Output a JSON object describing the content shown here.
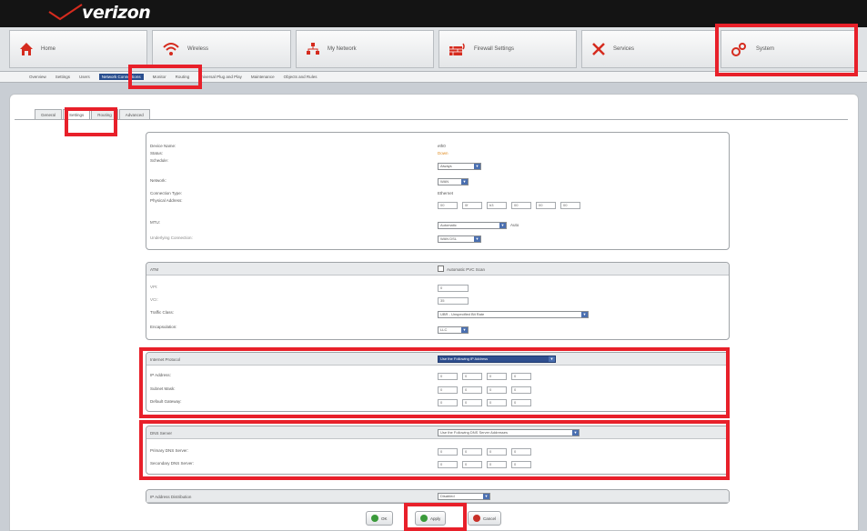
{
  "brand": {
    "name": "verizon"
  },
  "nav": [
    {
      "label": "Home",
      "icon": "home-icon"
    },
    {
      "label": "Wireless",
      "icon": "wireless-icon"
    },
    {
      "label": "My Network",
      "icon": "network-icon"
    },
    {
      "label": "Firewall Settings",
      "icon": "firewall-icon"
    },
    {
      "label": "Services",
      "icon": "services-icon"
    },
    {
      "label": "System",
      "icon": "system-icon"
    }
  ],
  "subnav": [
    "Overview",
    "Settings",
    "Users",
    "Network Connections",
    "Monitor",
    "Routing",
    "Universal Plug and Play",
    "Maintenance",
    "Objects and Rules"
  ],
  "tabs": [
    "General",
    "Settings",
    "Routing",
    "Advanced"
  ],
  "general": {
    "device_name_label": "Device Name:",
    "device_name": "eth0",
    "status_label": "Status:",
    "status": "Down",
    "schedule_label": "Schedule:",
    "schedule": "Always",
    "network_label": "Network:",
    "network": "WAN",
    "connection_type_label": "Connection Type:",
    "connection_type": "Ethernet",
    "physical_address_label": "Physical Address:",
    "mac": [
      "00",
      "0f",
      "b3",
      "00",
      "00",
      "00"
    ],
    "mtu_label": "MTU:",
    "mtu": "Automatic",
    "mtu_unit": "Auto",
    "underlying_label": "Underlying Connection:",
    "underlying": "WAN DSL"
  },
  "atm": {
    "title": "ATM",
    "auto_pvc_label": "Automatic PVC Scan",
    "vpi_label": "VPI:",
    "vpi": "0",
    "vci_label": "VCI:",
    "vci": "35",
    "traffic_label": "Traffic Class:",
    "traffic": "UBR - Unspecified Bit Rate",
    "encap_label": "Encapsulation:",
    "encap": "LLC"
  },
  "ip": {
    "title": "Internet Protocol",
    "mode": "Use the Following IP Address",
    "ip_label": "IP Address:",
    "ip": [
      "0",
      "0",
      "0",
      "0"
    ],
    "mask_label": "Subnet Mask:",
    "mask": [
      "0",
      "0",
      "0",
      "0"
    ],
    "gw_label": "Default Gateway:",
    "gw": [
      "0",
      "0",
      "0",
      "0"
    ]
  },
  "dns": {
    "title": "DNS Server",
    "mode": "Use the Following DNS Server Addresses",
    "primary_label": "Primary DNS Server:",
    "primary": [
      "0",
      "0",
      "0",
      "0"
    ],
    "secondary_label": "Secondary DNS Server:",
    "secondary": [
      "0",
      "0",
      "0",
      "0"
    ]
  },
  "ipdist": {
    "title": "IP Address Distribution",
    "value": "Disabled"
  },
  "buttons": {
    "ok": "OK",
    "apply": "Apply",
    "cancel": "Cancel"
  },
  "colors": {
    "highlight": "#e8202a",
    "brand_red": "#d52b1e",
    "topbar": "#141414"
  }
}
